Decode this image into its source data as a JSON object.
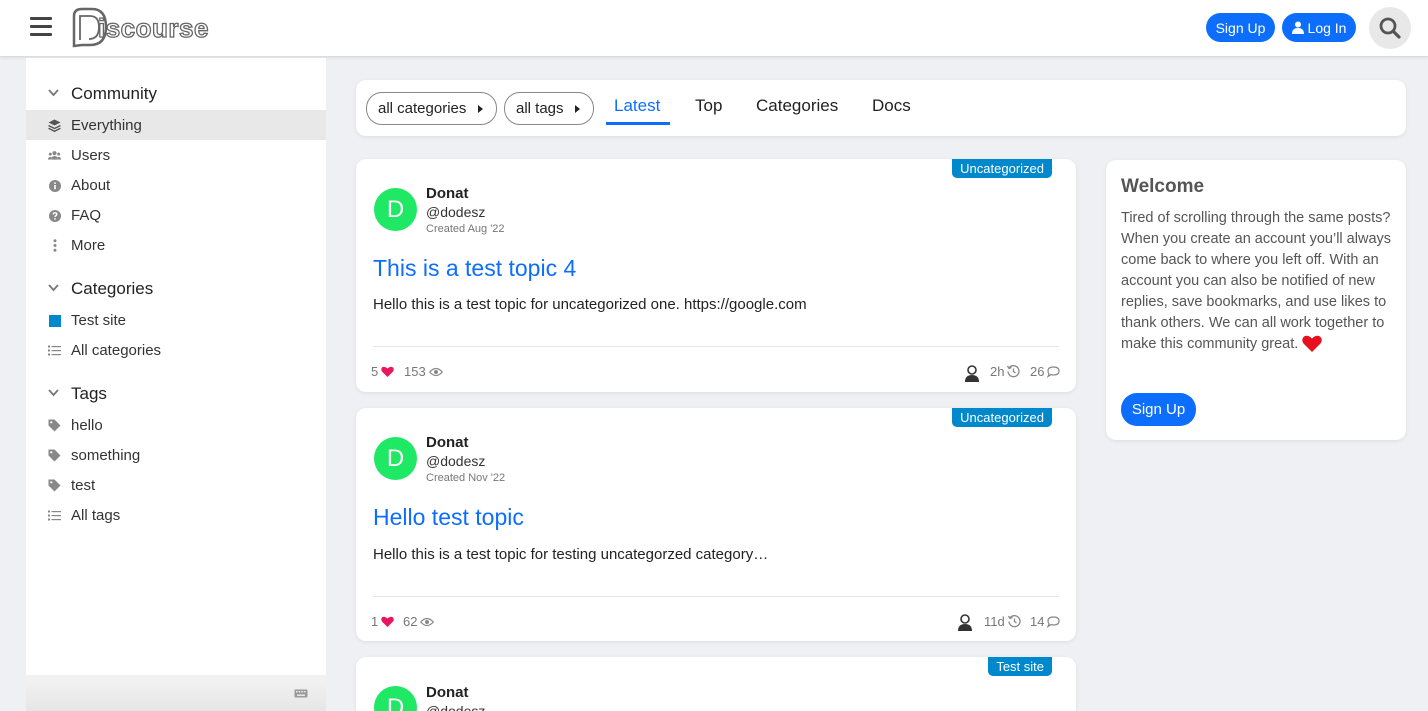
{
  "header": {
    "logo_text": "iscourse",
    "signup_label": "Sign Up",
    "login_label": "Log In"
  },
  "sidebar": {
    "community": {
      "title": "Community",
      "items": [
        "Everything",
        "Users",
        "About",
        "FAQ",
        "More"
      ]
    },
    "categories": {
      "title": "Categories",
      "items": [
        "Test site",
        "All categories"
      ]
    },
    "tags": {
      "title": "Tags",
      "items": [
        "hello",
        "something",
        "test",
        "All tags"
      ]
    }
  },
  "nav": {
    "all_categories": "all categories",
    "all_tags": "all tags",
    "tabs": [
      "Latest",
      "Top",
      "Categories",
      "Docs"
    ]
  },
  "topics": [
    {
      "category": "Uncategorized",
      "avatar_letter": "D",
      "author": "Donat",
      "handle": "@dodesz",
      "created": "Created Aug '22",
      "title": "This is a test topic 4",
      "excerpt": "Hello this is a test topic for uncategorized one. https://google.com",
      "likes": "5",
      "views": "153",
      "activity": "2h",
      "replies": "26"
    },
    {
      "category": "Uncategorized",
      "avatar_letter": "D",
      "author": "Donat",
      "handle": "@dodesz",
      "created": "Created Nov '22",
      "title": "Hello test topic",
      "excerpt": "Hello this is a test topic for testing uncategorzed category…",
      "likes": "1",
      "views": "62",
      "activity": "11d",
      "replies": "14"
    },
    {
      "category": "Test site",
      "avatar_letter": "D",
      "author": "Donat",
      "handle": "@dodesz"
    }
  ],
  "welcome": {
    "title": "Welcome",
    "text": "Tired of scrolling through the same posts? When you create an account you’ll always come back to where you left off. With an account you can also be notified of new replies, save bookmarks, and use likes to thank others. We can all work together to make this community great.",
    "signup_label": "Sign Up"
  },
  "colors": {
    "accent": "#0d6efd",
    "category_badge": "#0088cc",
    "avatar": "#1ee864",
    "heart": "#e8175d",
    "category_square": "#0088cc"
  }
}
